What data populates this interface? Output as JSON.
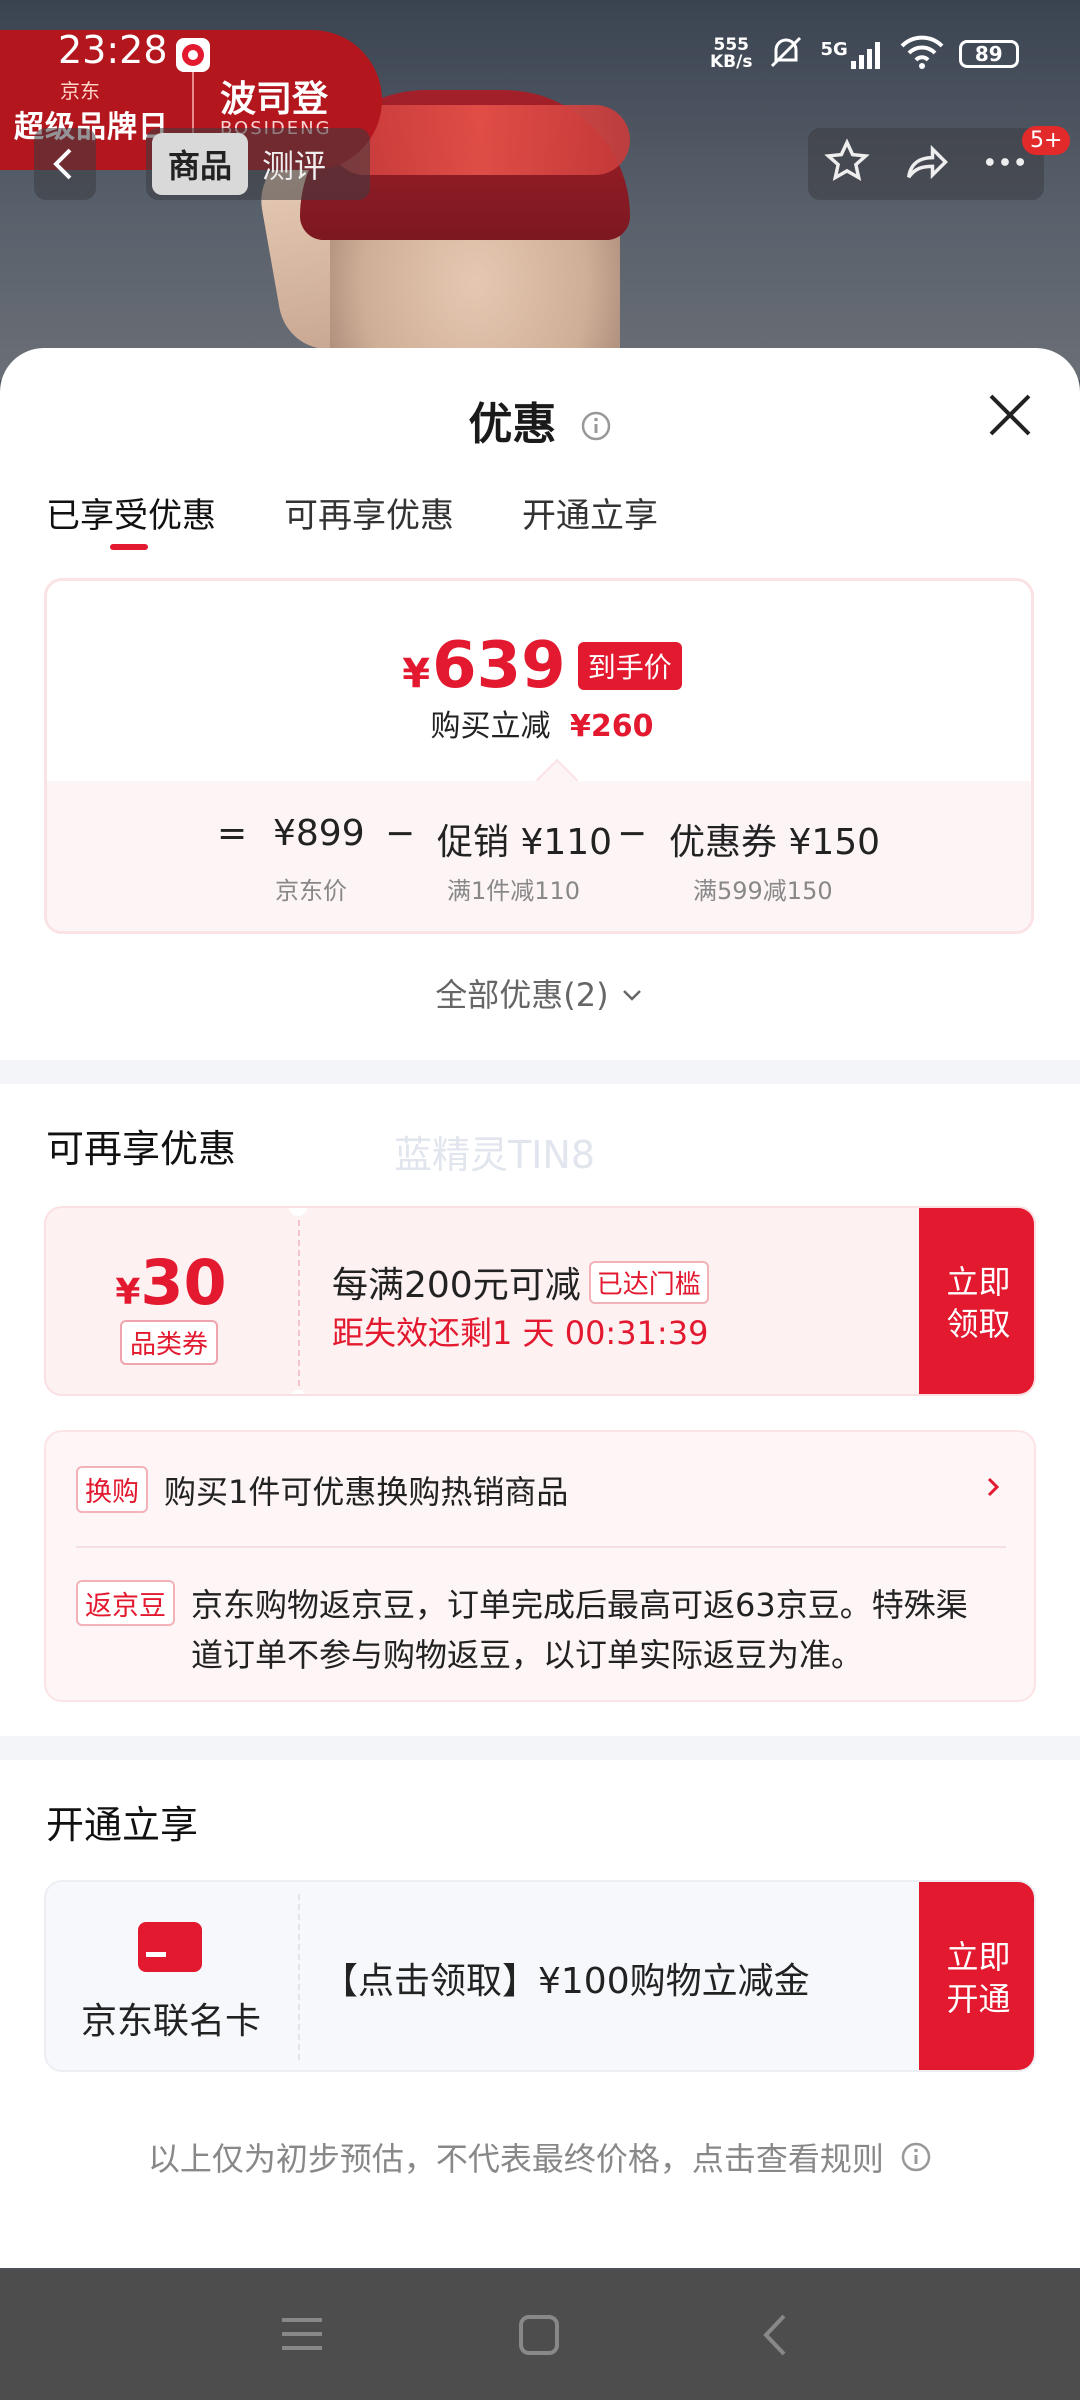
{
  "status_bar": {
    "time": "23:28",
    "net_speed_value": "555",
    "net_speed_unit": "KB/s",
    "network": "5G",
    "battery": "89"
  },
  "brand_banner": {
    "jd_small": "京东",
    "event": "超级品牌日",
    "brand_cn": "波司登",
    "brand_en": "BOSIDENG"
  },
  "nav": {
    "tab_active": "商品",
    "tab_other": "测评",
    "badge": "5+"
  },
  "sheet": {
    "title": "优惠",
    "tabs": [
      "已享受优惠",
      "可再享优惠",
      "开通立享"
    ]
  },
  "price_card": {
    "currency": "¥",
    "final_price": "639",
    "final_tag": "到手价",
    "cut_label": "购买立减",
    "cut_amount": "¥260",
    "eq": "=",
    "jd_price": "¥899",
    "minus": "−",
    "promo": "促销 ¥110",
    "coupon": "优惠券 ¥150",
    "jd_price_label": "京东价",
    "promo_note": "满1件减110",
    "coupon_note": "满599减150"
  },
  "all_offers": "全部优惠(2)",
  "more_section": {
    "title": "可再享优惠",
    "watermark": "蓝精灵TIN8",
    "coupon": {
      "currency": "¥",
      "amount": "30",
      "category": "品类券",
      "condition": "每满200元可减",
      "reached": "已达门槛",
      "expire": "距失效还剩1 天 00:31:39",
      "claim_line1": "立即",
      "claim_line2": "领取"
    },
    "exchange": {
      "tag": "换购",
      "text": "购买1件可优惠换购热销商品"
    },
    "beans": {
      "tag": "返京豆",
      "text": "京东购物返京豆，订单完成后最高可返63京豆。特殊渠道订单不参与购物返豆，以订单实际返豆为准。"
    }
  },
  "open_section": {
    "title": "开通立享",
    "card_name": "京东联名卡",
    "offer": "【点击领取】¥100购物立减金",
    "btn_line1": "立即",
    "btn_line2": "开通"
  },
  "footnote": "以上仅为初步预估，不代表最终价格，点击查看规则",
  "colors": {
    "accent": "#e3192f",
    "light_pink": "#fdf4f5",
    "divider": "#f4f5f9"
  }
}
